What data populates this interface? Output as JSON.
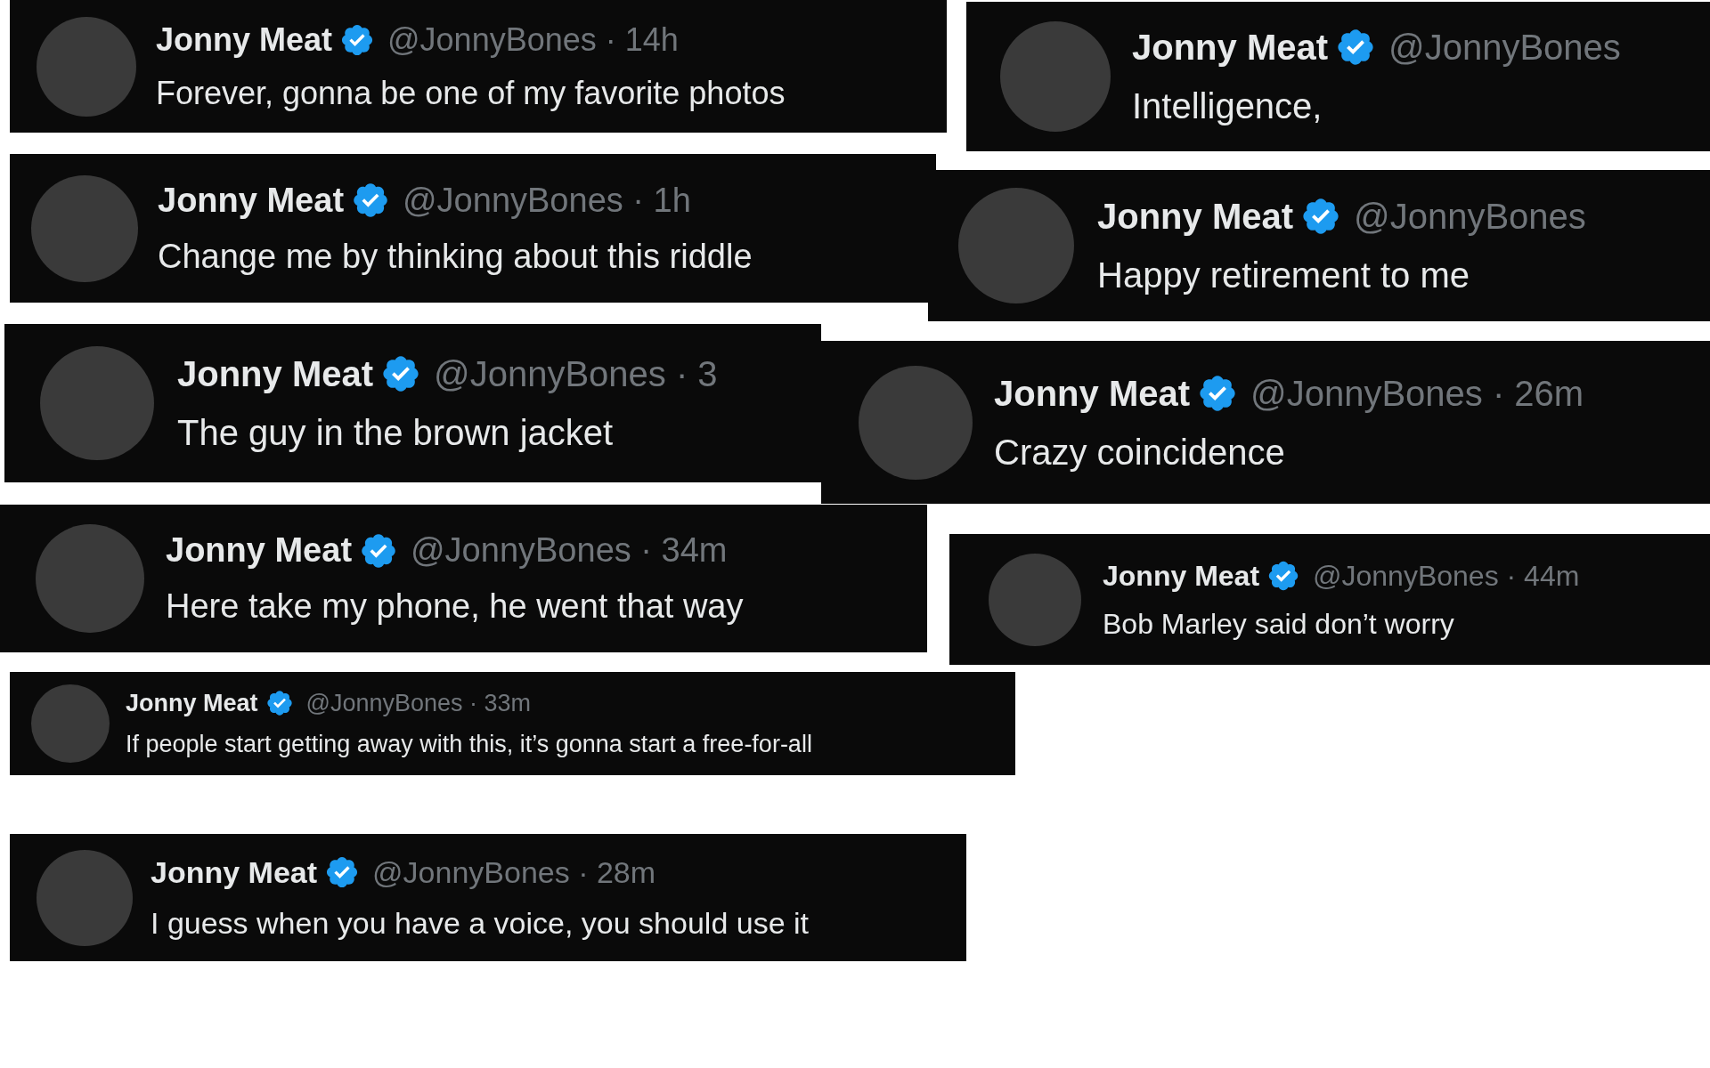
{
  "tweets": [
    {
      "name": "Jonny Meat",
      "verified": true,
      "meta": "@JonnyBones · 14h",
      "text": "Forever, gonna be one of my favorite photos"
    },
    {
      "name": "Jonny Meat",
      "verified": true,
      "meta": "@JonnyBones",
      "text": "Intelligence,"
    },
    {
      "name": "Jonny Meat",
      "verified": true,
      "meta": "@JonnyBones · 1h",
      "text": "Change me by thinking about this riddle"
    },
    {
      "name": "Jonny Meat",
      "verified": true,
      "meta": "@JonnyBones",
      "text": "Happy retirement to me"
    },
    {
      "name": "Jonny Meat",
      "verified": true,
      "meta": "@JonnyBones · 3",
      "text": "The guy in the brown jacket"
    },
    {
      "name": "Jonny Meat",
      "verified": true,
      "meta": "@JonnyBones · 26m",
      "text": "Crazy coincidence"
    },
    {
      "name": "Jonny Meat",
      "verified": true,
      "meta": "@JonnyBones · 34m",
      "text": "Here take my phone, he went that way"
    },
    {
      "name": "Jonny Meat",
      "verified": true,
      "meta": "@JonnyBones · 44m",
      "text": "Bob Marley said don’t worry"
    },
    {
      "name": "Jonny Meat",
      "verified": true,
      "meta": "@JonnyBones · 33m",
      "text": "If people start getting away with this, it’s gonna start a free-for-all"
    },
    {
      "name": "Jonny Meat",
      "verified": true,
      "meta": "@JonnyBones · 28m",
      "text": "I guess when you have a voice, you should use it"
    }
  ]
}
